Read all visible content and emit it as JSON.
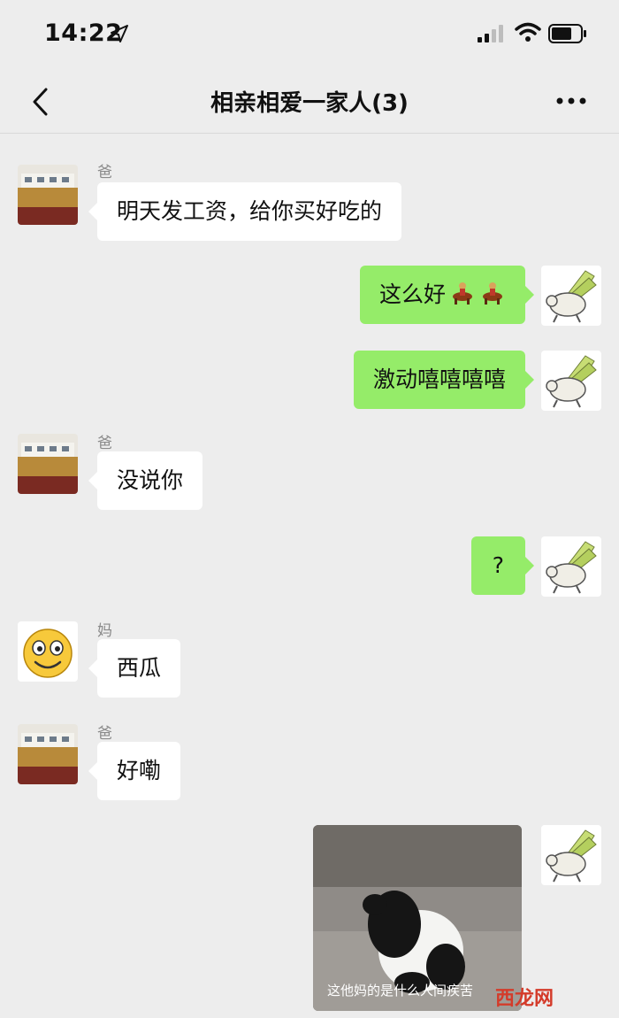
{
  "status_bar": {
    "time": "14:22"
  },
  "header": {
    "title": "相亲相爱一家人(3)"
  },
  "messages": [
    {
      "sender": "爸",
      "text": "明天发工资，给你买好吃的"
    },
    {
      "text": "这么好"
    },
    {
      "text": "激动嘻嘻嘻嘻"
    },
    {
      "sender": "爸",
      "text": "没说你"
    },
    {
      "text": "?"
    },
    {
      "sender": "妈",
      "text": "西瓜"
    },
    {
      "sender": "爸",
      "text": "好嘞"
    },
    {
      "image_caption": "这他妈的是什么人间疾苦"
    }
  ],
  "watermark": "西龙网",
  "colors": {
    "outgoing_bubble": "#95ec69",
    "incoming_bubble": "#ffffff",
    "background": "#ededed"
  }
}
